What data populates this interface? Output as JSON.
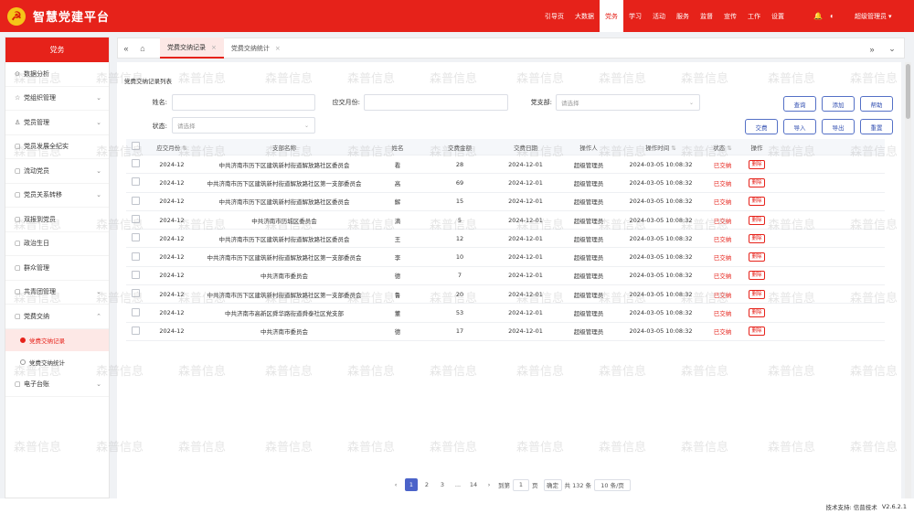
{
  "app": {
    "title": "智慧党建平台",
    "logo_glyph": "☭"
  },
  "topnav": [
    {
      "label": "引导页",
      "active": false
    },
    {
      "label": "大数据",
      "active": false
    },
    {
      "label": "党务",
      "active": true
    },
    {
      "label": "学习",
      "active": false
    },
    {
      "label": "活动",
      "active": false
    },
    {
      "label": "服务",
      "active": false
    },
    {
      "label": "监督",
      "active": false
    },
    {
      "label": "宣传",
      "active": false
    },
    {
      "label": "工作",
      "active": false
    },
    {
      "label": "设置",
      "active": false
    }
  ],
  "user": {
    "name": "超级管理员",
    "arrow": "▾"
  },
  "top_icons": {
    "bell": "🔔",
    "theme": "◐"
  },
  "sidebar": {
    "header": "党务",
    "items": [
      {
        "label": "数据分析",
        "icon": "⊙",
        "chevron": ""
      },
      {
        "label": "党组织管理",
        "icon": "☆",
        "chevron": "⌄"
      },
      {
        "label": "党员管理",
        "icon": "♙",
        "chevron": "⌄"
      },
      {
        "label": "党员发展全纪实",
        "icon": "▢",
        "chevron": ""
      },
      {
        "label": "流动党员",
        "icon": "▢",
        "chevron": "⌄"
      },
      {
        "label": "党员关系转移",
        "icon": "▢",
        "chevron": "⌄"
      },
      {
        "label": "双报到党员",
        "icon": "▢",
        "chevron": ""
      },
      {
        "label": "政治生日",
        "icon": "▢",
        "chevron": ""
      },
      {
        "label": "群众管理",
        "icon": "▢",
        "chevron": ""
      },
      {
        "label": "共青团管理",
        "icon": "▢",
        "chevron": "⌄"
      },
      {
        "label": "党费交纳",
        "icon": "▢",
        "chevron": "⌃"
      }
    ],
    "subitems": [
      {
        "label": "党费交纳记录",
        "active": true
      },
      {
        "label": "党费交纳统计",
        "active": false
      }
    ],
    "after_items": [
      {
        "label": "电子台账",
        "icon": "▢",
        "chevron": "⌄"
      }
    ]
  },
  "tabs": [
    {
      "label": "党费交纳记录",
      "active": true
    },
    {
      "label": "党费交纳统计",
      "active": false
    }
  ],
  "tabbar": {
    "prev": "«",
    "home": "⌂",
    "next": "»",
    "more": "⌄",
    "close": "×"
  },
  "filters": {
    "list_title": "党费交纳记录列表",
    "name_label": "姓名:",
    "name_placeholder": "",
    "month_label": "应交月份:",
    "month_placeholder": "",
    "branch_label": "党支部:",
    "branch_placeholder": "请选择",
    "status_label": "状态:",
    "status_placeholder": "请选择"
  },
  "buttons": {
    "query": "查询",
    "add": "添加",
    "help": "帮助",
    "pay": "交费",
    "import": "导入",
    "export": "导出",
    "reset": "重置"
  },
  "table": {
    "columns": [
      "应交月份",
      "支部名称",
      "姓名",
      "交费金额",
      "交费日期",
      "操作人",
      "操作时间",
      "状态",
      "操作"
    ],
    "rows": [
      {
        "month": "2024-12",
        "branch": "中共济南市历下区建筑新村街道解放路社区委员会",
        "name": "看",
        "amount": "28",
        "date": "2024-12-01",
        "operator": "超级管理员",
        "time": "2024-03-05 10:08:32",
        "status": "已交纳",
        "action": "删除"
      },
      {
        "month": "2024-12",
        "branch": "中共济南市历下区建筑新村街道解放路社区第一支部委员会",
        "name": "高",
        "amount": "69",
        "date": "2024-12-01",
        "operator": "超级管理员",
        "time": "2024-03-05 10:08:32",
        "status": "已交纳",
        "action": "删除"
      },
      {
        "month": "2024-12",
        "branch": "中共济南市历下区建筑新村街道解放路社区委员会",
        "name": "解",
        "amount": "15",
        "date": "2024-12-01",
        "operator": "超级管理员",
        "time": "2024-03-05 10:08:32",
        "status": "已交纳",
        "action": "删除"
      },
      {
        "month": "2024-12",
        "branch": "中共济南市历城区委员会",
        "name": "滴",
        "amount": "5",
        "date": "2024-12-01",
        "operator": "超级管理员",
        "time": "2024-03-05 10:08:32",
        "status": "已交纳",
        "action": "删除"
      },
      {
        "month": "2024-12",
        "branch": "中共济南市历下区建筑新村街道解放路社区委员会",
        "name": "王",
        "amount": "12",
        "date": "2024-12-01",
        "operator": "超级管理员",
        "time": "2024-03-05 10:08:32",
        "status": "已交纳",
        "action": "删除"
      },
      {
        "month": "2024-12",
        "branch": "中共济南市历下区建筑新村街道解放路社区第一支部委员会",
        "name": "李",
        "amount": "10",
        "date": "2024-12-01",
        "operator": "超级管理员",
        "time": "2024-03-05 10:08:32",
        "status": "已交纳",
        "action": "删除"
      },
      {
        "month": "2024-12",
        "branch": "中共济南市委员会",
        "name": "德",
        "amount": "7",
        "date": "2024-12-01",
        "operator": "超级管理员",
        "time": "2024-03-05 10:08:32",
        "status": "已交纳",
        "action": "删除"
      },
      {
        "month": "2024-12",
        "branch": "中共济南市历下区建筑新村街道解放路社区第一支部委员会",
        "name": "鲁",
        "amount": "20",
        "date": "2024-12-01",
        "operator": "超级管理员",
        "time": "2024-03-05 10:08:32",
        "status": "已交纳",
        "action": "删除"
      },
      {
        "month": "2024-12",
        "branch": "中共济南市高新区舜华路街道舜泰社区党支部",
        "name": "董",
        "amount": "53",
        "date": "2024-12-01",
        "operator": "超级管理员",
        "time": "2024-03-05 10:08:32",
        "status": "已交纳",
        "action": "删除"
      },
      {
        "month": "2024-12",
        "branch": "中共济南市委员会",
        "name": "德",
        "amount": "17",
        "date": "2024-12-01",
        "operator": "超级管理员",
        "time": "2024-03-05 10:08:32",
        "status": "已交纳",
        "action": "删除"
      }
    ]
  },
  "pagination": {
    "prev": "‹",
    "pages": [
      "1",
      "2",
      "3",
      "...",
      "14"
    ],
    "active_page": "1",
    "next": "›",
    "goto_label": "到第",
    "goto_value": "1",
    "page_unit": "页",
    "confirm": "确定",
    "total": "共 132 条",
    "page_size": "10 条/页"
  },
  "footer": {
    "support": "技术支持: 信普技术",
    "version": "V2.6.2.1"
  },
  "watermark": "森普信息",
  "colors": {
    "brand_red": "#e6221a",
    "accent_blue": "#4b63c9"
  }
}
